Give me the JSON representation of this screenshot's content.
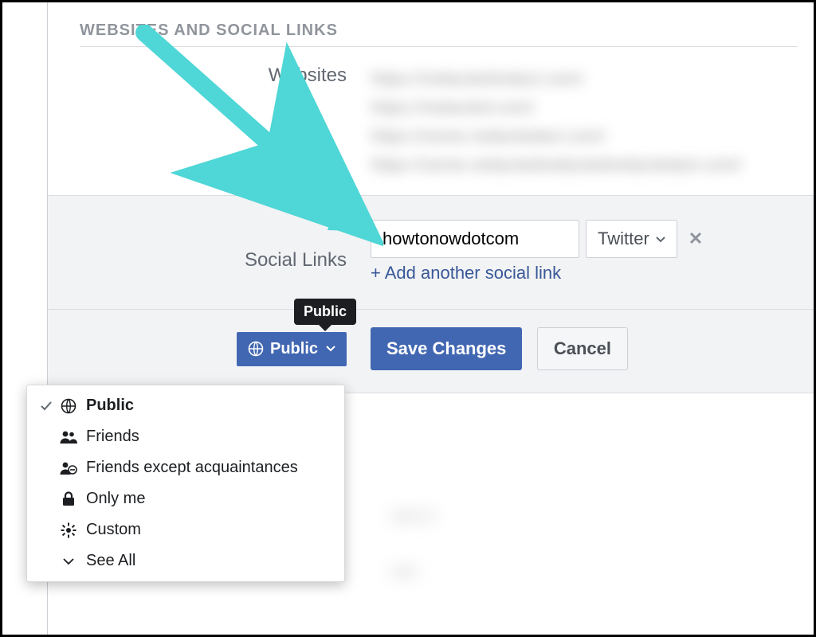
{
  "section_title": "WEBSITES AND SOCIAL LINKS",
  "labels": {
    "websites": "Websites",
    "social_links": "Social Links"
  },
  "social": {
    "username_value": "howtonowdotcom",
    "platform_label": "Twitter",
    "add_link_text": "+ Add another social link"
  },
  "privacy_button": {
    "label": "Public",
    "tooltip": "Public"
  },
  "actions": {
    "save": "Save Changes",
    "cancel": "Cancel"
  },
  "dropdown": {
    "items": [
      {
        "label": "Public",
        "icon": "globe",
        "selected": true
      },
      {
        "label": "Friends",
        "icon": "friends",
        "selected": false
      },
      {
        "label": "Friends except acquaintances",
        "icon": "friends-except",
        "selected": false
      },
      {
        "label": "Only me",
        "icon": "lock",
        "selected": false
      },
      {
        "label": "Custom",
        "icon": "gear",
        "selected": false
      },
      {
        "label": "See All",
        "icon": "caret",
        "selected": false
      }
    ]
  },
  "colors": {
    "primary": "#4267b2",
    "link": "#385898",
    "arrow": "#4fd6d6"
  }
}
